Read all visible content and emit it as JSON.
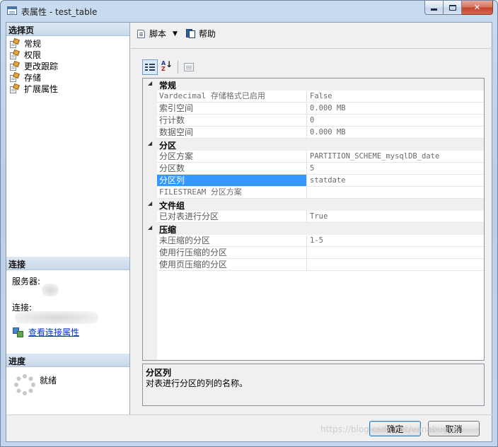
{
  "window": {
    "title": "表属性 - test_table",
    "minimize_icon": "minimize-icon",
    "maximize_icon": "maximize-icon",
    "close_glyph": "✕"
  },
  "left_pane": {
    "select_page_header": "选择页",
    "pages": [
      {
        "label": "常规",
        "icon": "page-wrench-icon"
      },
      {
        "label": "权限",
        "icon": "page-wrench-icon"
      },
      {
        "label": "更改跟踪",
        "icon": "page-wrench-icon"
      },
      {
        "label": "存储",
        "icon": "page-wrench-icon"
      },
      {
        "label": "扩展属性",
        "icon": "page-wrench-icon"
      }
    ],
    "connection_header": "连接",
    "server_label": "服务器:",
    "connection_label": "连接:",
    "view_connection_link": "查看连接属性",
    "progress_header": "进度",
    "progress_status": "就绪"
  },
  "toolbar": {
    "script_label": "脚本",
    "dropdown_glyph": "▼",
    "help_label": "帮助"
  },
  "property_grid": {
    "categories": [
      {
        "name": "常规",
        "properties": [
          {
            "name": "Vardecimal 存储格式已启用",
            "value": "False"
          },
          {
            "name": "索引空间",
            "value": "0.000 MB"
          },
          {
            "name": "行计数",
            "value": "0"
          },
          {
            "name": "数据空间",
            "value": "0.000 MB"
          }
        ]
      },
      {
        "name": "分区",
        "properties": [
          {
            "name": "分区方案",
            "value": "PARTITION_SCHEME_mysqlDB_date"
          },
          {
            "name": "分区数",
            "value": "5"
          },
          {
            "name": "分区列",
            "value": "statdate",
            "selected": true
          },
          {
            "name": "FILESTREAM 分区方案",
            "value": ""
          }
        ]
      },
      {
        "name": "文件组",
        "properties": [
          {
            "name": "已对表进行分区",
            "value": "True"
          }
        ]
      },
      {
        "name": "压缩",
        "properties": [
          {
            "name": "未压缩的分区",
            "value": "1-5"
          },
          {
            "name": "使用行压缩的分区",
            "value": ""
          },
          {
            "name": "使用页压缩的分区",
            "value": ""
          }
        ]
      }
    ],
    "collapse_glyph": "◢"
  },
  "description": {
    "title": "分区列",
    "text": "对表进行分区的列的名称。"
  },
  "buttons": {
    "ok": "确定",
    "cancel": "取消"
  },
  "watermark": "https://blog.csdn.net/vanabuguo",
  "colors": {
    "selection": "#3399ff",
    "link": "#0033cc",
    "header_gradient_start": "#dde8f3"
  }
}
